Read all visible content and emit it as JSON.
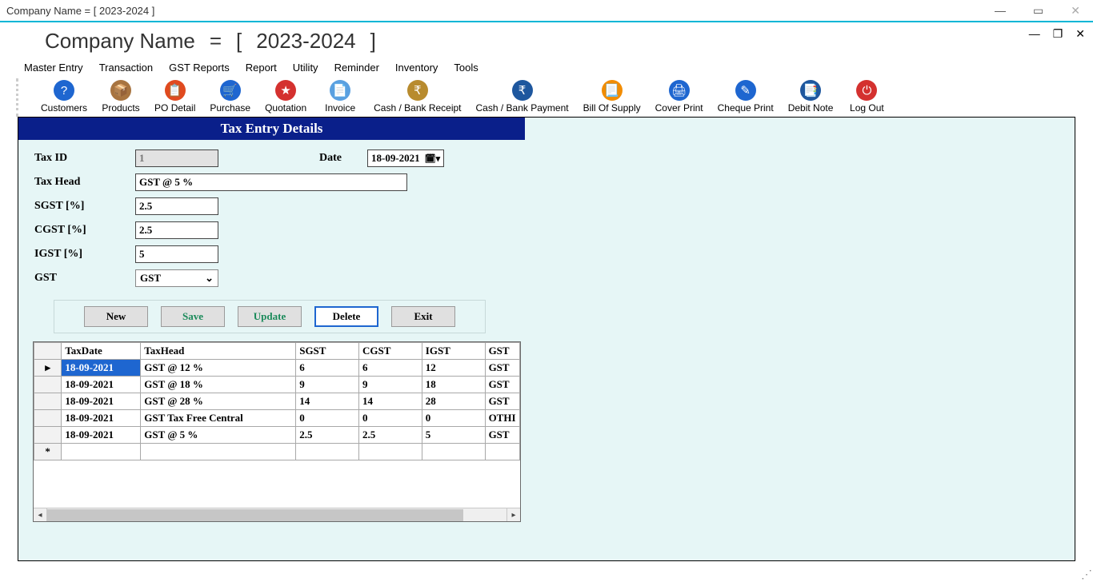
{
  "outer_title": "Company Name    =    [   2023-2024   ]",
  "header": {
    "company": "Company Name",
    "eq": "=",
    "year_left": "[",
    "year": "2023-2024",
    "year_right": "]"
  },
  "menu": {
    "items": [
      "Master Entry",
      "Transaction",
      "GST Reports",
      "Report",
      "Utility",
      "Reminder",
      "Inventory",
      "Tools"
    ]
  },
  "toolbar": {
    "items": [
      {
        "label": "Customers",
        "icon": "customers",
        "glyph": "?"
      },
      {
        "label": "Products",
        "icon": "products",
        "glyph": "📦"
      },
      {
        "label": "PO Detail",
        "icon": "po",
        "glyph": "📋"
      },
      {
        "label": "Purchase",
        "icon": "purchase",
        "glyph": "🛒"
      },
      {
        "label": "Quotation",
        "icon": "quotation",
        "glyph": "★"
      },
      {
        "label": "Invoice",
        "icon": "invoice",
        "glyph": "📄"
      },
      {
        "label": "Cash / Bank Receipt",
        "icon": "cashreceipt",
        "glyph": "₹"
      },
      {
        "label": "Cash / Bank Payment",
        "icon": "cashpayment",
        "glyph": "₹"
      },
      {
        "label": "Bill Of Supply",
        "icon": "billsupply",
        "glyph": "📃"
      },
      {
        "label": "Cover Print",
        "icon": "coverprint",
        "glyph": "🖨"
      },
      {
        "label": "Cheque Print",
        "icon": "chequeprint",
        "glyph": "✎"
      },
      {
        "label": "Debit Note",
        "icon": "debitnote",
        "glyph": "📑"
      },
      {
        "label": "Log Out",
        "icon": "logout",
        "glyph": "⏻"
      }
    ]
  },
  "form": {
    "title": "Tax Entry Details",
    "labels": {
      "tax_id": "Tax ID",
      "date": "Date",
      "tax_head": "Tax Head",
      "sgst": "SGST [%]",
      "cgst": "CGST [%]",
      "igst": "IGST [%]",
      "gst": "GST"
    },
    "values": {
      "tax_id": "1",
      "date": "18-09-2021",
      "tax_head": "GST @ 5 %",
      "sgst": "2.5",
      "cgst": "2.5",
      "igst": "5",
      "gst": "GST"
    },
    "buttons": {
      "new": "New",
      "save": "Save",
      "update": "Update",
      "delete": "Delete",
      "exit": "Exit"
    }
  },
  "grid": {
    "columns": [
      "TaxDate",
      "TaxHead",
      "SGST",
      "CGST",
      "IGST",
      "GST"
    ],
    "rows": [
      {
        "TaxDate": "18-09-2021",
        "TaxHead": "GST @ 12 %",
        "SGST": "6",
        "CGST": "6",
        "IGST": "12",
        "GST": "GST"
      },
      {
        "TaxDate": "18-09-2021",
        "TaxHead": "GST @ 18 %",
        "SGST": "9",
        "CGST": "9",
        "IGST": "18",
        "GST": "GST"
      },
      {
        "TaxDate": "18-09-2021",
        "TaxHead": "GST @ 28 %",
        "SGST": "14",
        "CGST": "14",
        "IGST": "28",
        "GST": "GST"
      },
      {
        "TaxDate": "18-09-2021",
        "TaxHead": "GST Tax Free Central",
        "SGST": "0",
        "CGST": "0",
        "IGST": "0",
        "GST": "OTHI"
      },
      {
        "TaxDate": "18-09-2021",
        "TaxHead": "GST @ 5 %",
        "SGST": "2.5",
        "CGST": "2.5",
        "IGST": "5",
        "GST": "GST"
      }
    ]
  }
}
